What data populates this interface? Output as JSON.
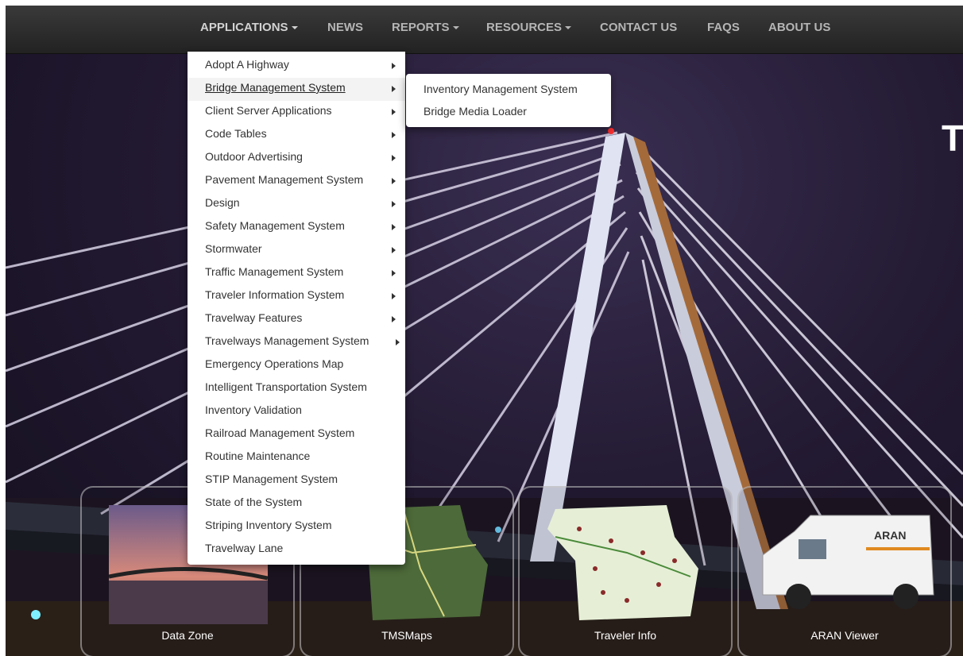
{
  "nav": {
    "items": [
      {
        "label": "APPLICATIONS",
        "caret": true
      },
      {
        "label": "NEWS",
        "caret": false
      },
      {
        "label": "REPORTS",
        "caret": true
      },
      {
        "label": "RESOURCES",
        "caret": true
      },
      {
        "label": "CONTACT US",
        "caret": false
      },
      {
        "label": "FAQS",
        "caret": false
      },
      {
        "label": "ABOUT US",
        "caret": false
      }
    ]
  },
  "applications_menu": {
    "items": [
      {
        "label": "Adopt A Highway",
        "has_submenu": true
      },
      {
        "label": "Bridge Management System",
        "has_submenu": true
      },
      {
        "label": "Client Server Applications",
        "has_submenu": true
      },
      {
        "label": "Code Tables",
        "has_submenu": true
      },
      {
        "label": "Outdoor Advertising",
        "has_submenu": true
      },
      {
        "label": "Pavement Management System",
        "has_submenu": true
      },
      {
        "label": "Design",
        "has_submenu": true
      },
      {
        "label": "Safety Management System",
        "has_submenu": true
      },
      {
        "label": "Stormwater",
        "has_submenu": true
      },
      {
        "label": "Traffic Management System",
        "has_submenu": true
      },
      {
        "label": "Traveler Information System",
        "has_submenu": true
      },
      {
        "label": "Travelway Features",
        "has_submenu": true
      },
      {
        "label": "Travelways Management System",
        "has_submenu": true
      },
      {
        "label": "Emergency Operations Map",
        "has_submenu": false
      },
      {
        "label": "Intelligent Transportation System",
        "has_submenu": false
      },
      {
        "label": "Inventory Validation",
        "has_submenu": false
      },
      {
        "label": "Railroad Management System",
        "has_submenu": false
      },
      {
        "label": "Routine Maintenance",
        "has_submenu": false
      },
      {
        "label": "STIP Management System",
        "has_submenu": false
      },
      {
        "label": "State of the System",
        "has_submenu": false
      },
      {
        "label": "Striping Inventory System",
        "has_submenu": false
      },
      {
        "label": "Travelway Lane",
        "has_submenu": false
      }
    ]
  },
  "bridge_submenu": {
    "items": [
      {
        "label": "Inventory Management System"
      },
      {
        "label": "Bridge Media Loader"
      }
    ]
  },
  "hero": {
    "partial_heading_letter": "T"
  },
  "tiles": [
    {
      "label": "Data Zone"
    },
    {
      "label": "TMSMaps"
    },
    {
      "label": "Traveler Info"
    },
    {
      "label": "ARAN Viewer"
    }
  ],
  "van_logo_text": "ARAN",
  "colors": {
    "nav_text": "#b5b5b5",
    "menu_text": "#333333",
    "hero_sky": "#241b34"
  }
}
